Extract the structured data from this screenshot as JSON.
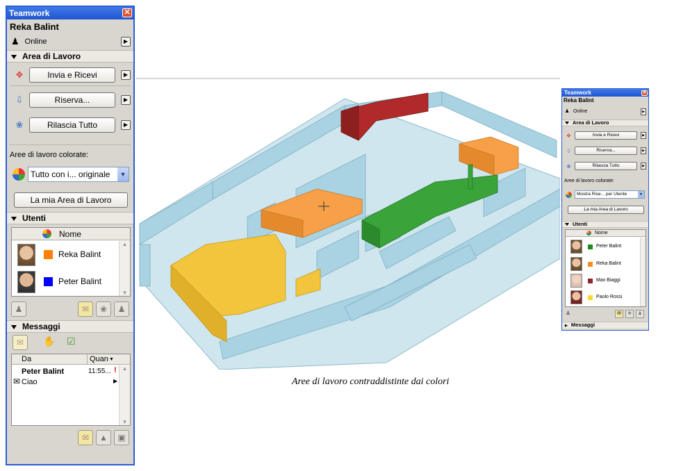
{
  "left_panel": {
    "title": "Teamwork",
    "close_glyph": "✕",
    "user_name": "Reka Balint",
    "status": "Online",
    "area_section": "Area di Lavoro",
    "buttons": {
      "send_receive": "Invia e Ricevi",
      "reserve": "Riserva...",
      "release_all": "Rilascia Tutto",
      "my_area": "La mia Area di Lavoro"
    },
    "colored_areas_label": "Aree di lavoro colorate:",
    "colored_areas_value": "Tutto con i... originale",
    "users_section": "Utenti",
    "users_header": "Nome",
    "users": [
      {
        "name": "Reka Balint",
        "color": "#ff7f00"
      },
      {
        "name": "Peter Balint",
        "color": "#0000ff"
      }
    ],
    "messages_section": "Messaggi",
    "messages_header": {
      "from": "Da",
      "when": "Quan"
    },
    "messages": [
      {
        "from": "Peter Balint",
        "time": "11:55...",
        "text": "Ciao"
      }
    ]
  },
  "caption": "Aree di lavoro contraddistinte dai colori",
  "right_panel": {
    "title": "Teamwork",
    "user_name": "Reka Balint",
    "status": "Online",
    "area_section": "Area di Lavoro",
    "buttons": {
      "send_receive": "Invia e Ricevi",
      "reserve": "Riserva...",
      "release_all": "Rilascia Tutto",
      "my_area": "La mia Area di Lavoro"
    },
    "colored_areas_label": "Aree di lavoro colorate:",
    "colored_areas_value": "Mostra Rise... per Utente",
    "users_section": "Utenti",
    "users_header": "Nome",
    "users": [
      {
        "name": "Peter Balint",
        "color": "#1f8a1f"
      },
      {
        "name": "Reka Balint",
        "color": "#ff8c1a"
      },
      {
        "name": "Max Biaggi",
        "color": "#8b2a2a"
      },
      {
        "name": "Paolo Rossi",
        "color": "#ffd633"
      }
    ],
    "messages_section": "Messaggi"
  },
  "colors": {
    "titlebar": "#2a5cd6",
    "plan_base": "#a9d3e3",
    "zone_orange": "#f7a047",
    "zone_green": "#3aa33a",
    "zone_yellow": "#f2c53d",
    "zone_red": "#b02a2a"
  }
}
